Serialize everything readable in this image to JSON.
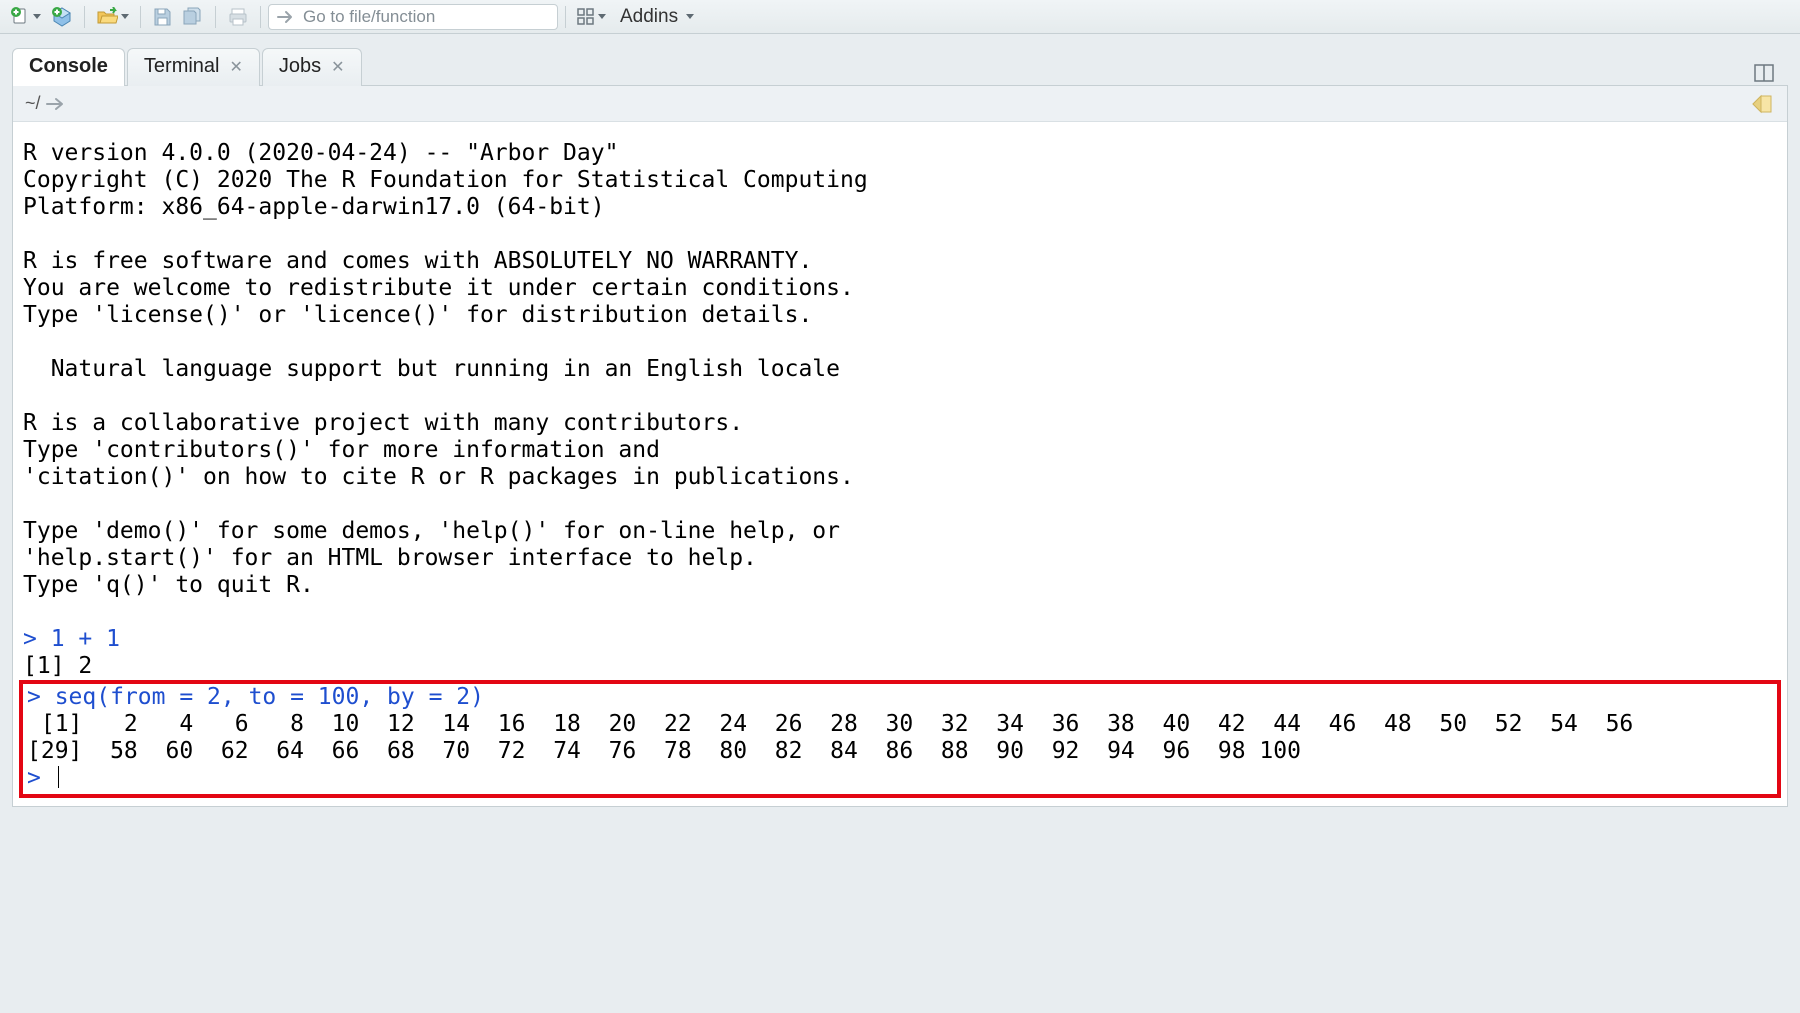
{
  "toolbar": {
    "goto_placeholder": "Go to file/function",
    "addins_label": "Addins"
  },
  "tabs": [
    {
      "label": "Console",
      "closable": false,
      "active": true
    },
    {
      "label": "Terminal",
      "closable": true,
      "active": false
    },
    {
      "label": "Jobs",
      "closable": true,
      "active": false
    }
  ],
  "workdir": {
    "path": "~/"
  },
  "console_startup": "R version 4.0.0 (2020-04-24) -- \"Arbor Day\"\nCopyright (C) 2020 The R Foundation for Statistical Computing\nPlatform: x86_64-apple-darwin17.0 (64-bit)\n\nR is free software and comes with ABSOLUTELY NO WARRANTY.\nYou are welcome to redistribute it under certain conditions.\nType 'license()' or 'licence()' for distribution details.\n\n  Natural language support but running in an English locale\n\nR is a collaborative project with many contributors.\nType 'contributors()' for more information and\n'citation()' on how to cite R or R packages in publications.\n\nType 'demo()' for some demos, 'help()' for on-line help, or\n'help.start()' for an HTML browser interface to help.\nType 'q()' to quit R.\n",
  "console_cmd1": "1 + 1",
  "console_out1": "[1] 2",
  "console_cmd2": "seq(from = 2, to = 100, by = 2)",
  "console_out2a": " [1]   2   4   6   8  10  12  14  16  18  20  22  24  26  28  30  32  34  36  38  40  42  44  46  48  50  52  54  56",
  "console_out2b": "[29]  58  60  62  64  66  68  70  72  74  76  78  80  82  84  86  88  90  92  94  96  98 100",
  "prompt": "> "
}
